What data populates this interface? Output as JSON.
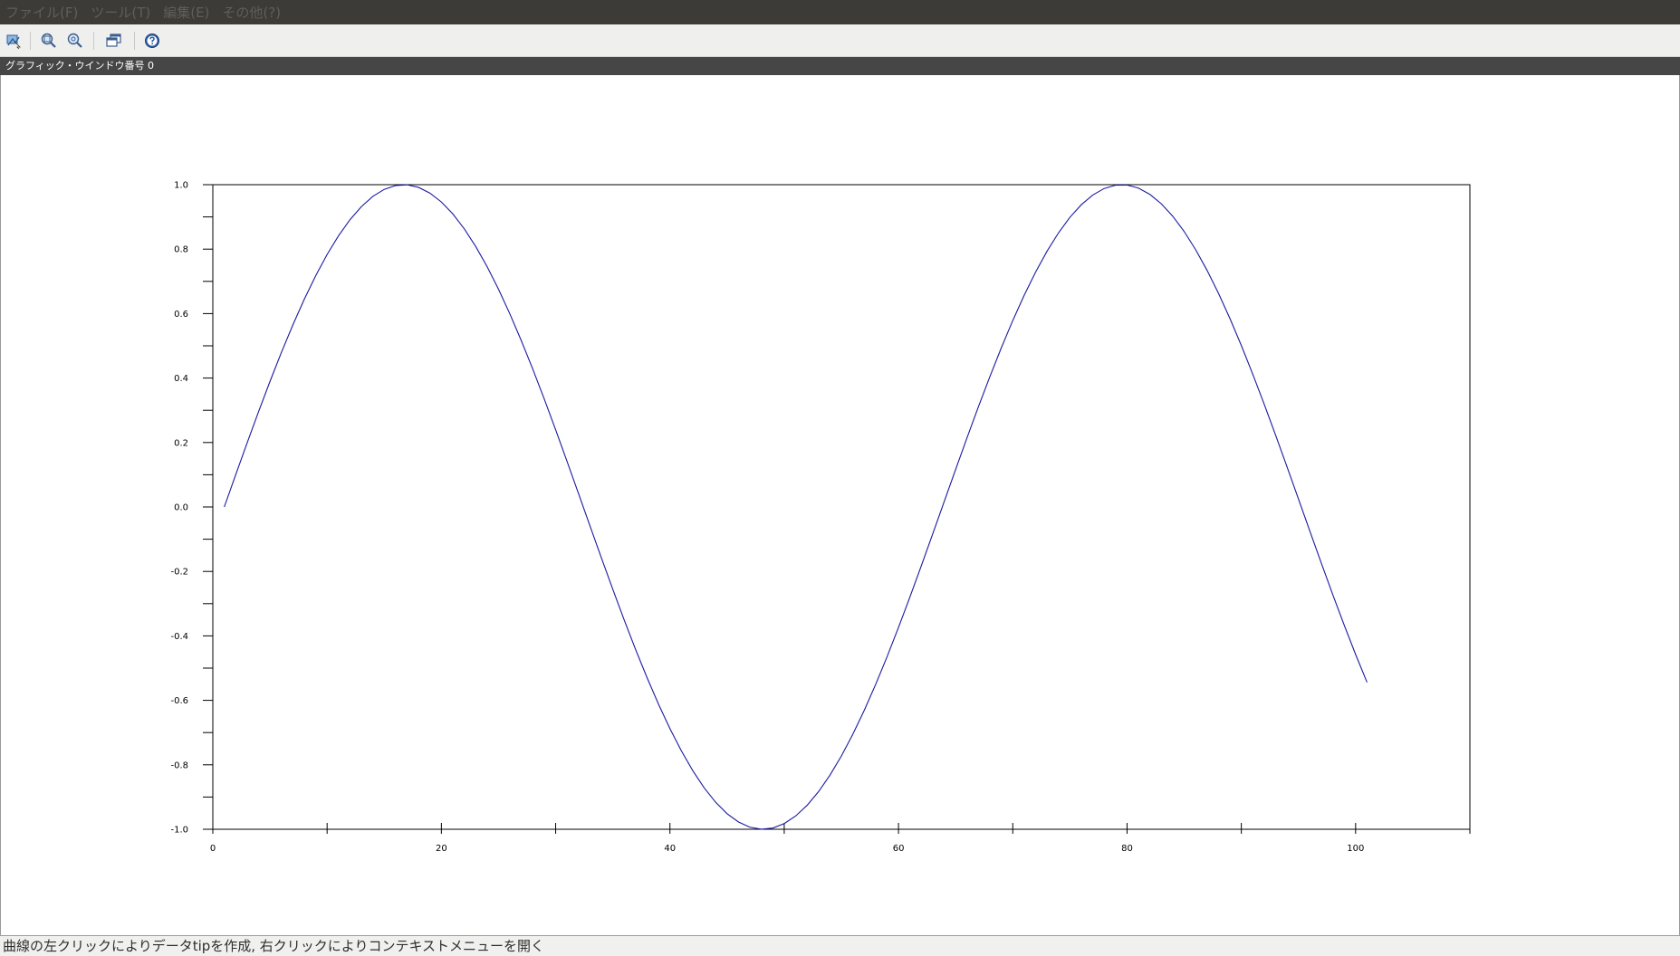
{
  "menubar": {
    "items": [
      {
        "label": "ファイル(F)"
      },
      {
        "label": "ツール(T)"
      },
      {
        "label": "編集(E)"
      },
      {
        "label": "その他(?)"
      }
    ]
  },
  "toolbar": {
    "buttons": [
      {
        "icon": "datatip-icon"
      },
      {
        "icon": "zoom-in-icon"
      },
      {
        "icon": "zoom-out-icon"
      },
      {
        "icon": "window-icon"
      },
      {
        "icon": "help-icon"
      }
    ]
  },
  "window": {
    "title": "グラフィック・ウインドウ番号 0"
  },
  "status": {
    "text": "曲線の左クリックによりデータtipを作成, 右クリックによりコンテキストメニューを開く"
  },
  "chart_data": {
    "type": "line",
    "title": "",
    "xlabel": "",
    "ylabel": "",
    "xlim": [
      0,
      110
    ],
    "ylim": [
      -1.0,
      1.0
    ],
    "x_ticks": [
      0,
      20,
      40,
      60,
      80,
      100
    ],
    "x_tick_labels": [
      "0",
      "20",
      "40",
      "60",
      "80",
      "100"
    ],
    "x_minor_step": 10,
    "y_ticks": [
      -1.0,
      -0.8,
      -0.6,
      -0.4,
      -0.2,
      0.0,
      0.2,
      0.4,
      0.6,
      0.8,
      1.0
    ],
    "y_tick_labels": [
      "-1.0",
      "-0.8",
      "-0.6",
      "-0.4",
      "-0.2",
      "0.0",
      "0.2",
      "0.4",
      "0.6",
      "0.8",
      "1.0"
    ],
    "y_minor_step": 0.1,
    "grid": false,
    "series": [
      {
        "color": "#1a1aa0",
        "x": [
          1,
          2,
          3,
          4,
          5,
          6,
          7,
          8,
          9,
          10,
          11,
          12,
          13,
          14,
          15,
          16,
          17,
          18,
          19,
          20,
          21,
          22,
          23,
          24,
          25,
          26,
          27,
          28,
          29,
          30,
          31,
          32,
          33,
          34,
          35,
          36,
          37,
          38,
          39,
          40,
          41,
          42,
          43,
          44,
          45,
          46,
          47,
          48,
          49,
          50,
          51,
          52,
          53,
          54,
          55,
          56,
          57,
          58,
          59,
          60,
          61,
          62,
          63,
          64,
          65,
          66,
          67,
          68,
          69,
          70,
          71,
          72,
          73,
          74,
          75,
          76,
          77,
          78,
          79,
          80,
          81,
          82,
          83,
          84,
          85,
          86,
          87,
          88,
          89,
          90,
          91,
          92,
          93,
          94,
          95,
          96,
          97,
          98,
          99,
          100,
          101
        ],
        "y": [
          0.0,
          0.0998,
          0.1987,
          0.2955,
          0.3894,
          0.4794,
          0.5646,
          0.6442,
          0.7174,
          0.7833,
          0.8415,
          0.8912,
          0.932,
          0.9636,
          0.9854,
          0.9975,
          0.9996,
          0.9917,
          0.9738,
          0.9463,
          0.9093,
          0.8632,
          0.8085,
          0.7457,
          0.6755,
          0.5985,
          0.5155,
          0.4274,
          0.335,
          0.2392,
          0.1411,
          0.0416,
          -0.0584,
          -0.1577,
          -0.2555,
          -0.3508,
          -0.4425,
          -0.5298,
          -0.6119,
          -0.6878,
          -0.7568,
          -0.8183,
          -0.8716,
          -0.9162,
          -0.9516,
          -0.9775,
          -0.9937,
          -0.9999,
          -0.9962,
          -0.9825,
          -0.9589,
          -0.9258,
          -0.8835,
          -0.8323,
          -0.7728,
          -0.7055,
          -0.6313,
          -0.5507,
          -0.4646,
          -0.3739,
          -0.2794,
          -0.1822,
          -0.0831,
          0.0168,
          0.1165,
          0.215,
          0.3115,
          0.4048,
          0.494,
          0.5784,
          0.657,
          0.729,
          0.7937,
          0.8504,
          0.8987,
          0.938,
          0.9679,
          0.9882,
          0.9985,
          0.9989,
          0.9894,
          0.9699,
          0.9407,
          0.9022,
          0.8546,
          0.7985,
          0.7344,
          0.663,
          0.585,
          0.501,
          0.4121,
          0.319,
          0.2229,
          0.1245,
          0.0248,
          -0.0752,
          -0.1743,
          -0.2718,
          -0.3665,
          -0.4575,
          -0.544
        ]
      }
    ]
  }
}
